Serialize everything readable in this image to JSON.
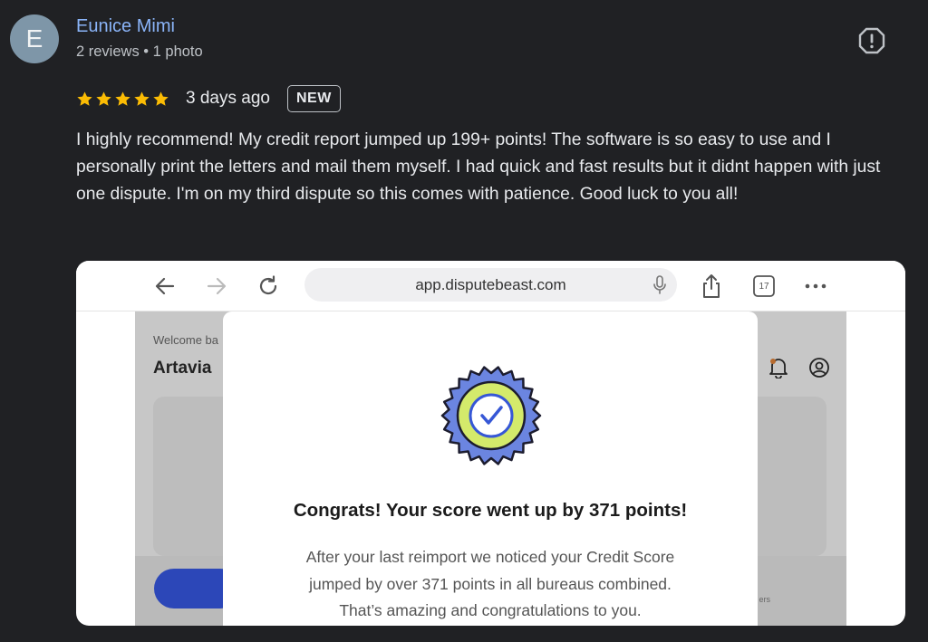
{
  "reviewer": {
    "initial": "E",
    "name": "Eunice Mimi",
    "meta": "2 reviews • 1 photo"
  },
  "review": {
    "stars": 5,
    "star_color": "#fbbc04",
    "date": "3 days ago",
    "badge": "NEW",
    "text": "I highly recommend! My credit report jumped up 199+ points! The software is so easy to use and I personally print the letters and mail them myself. I had quick and fast results but it didnt happen with just one dispute. I'm on my third dispute so this comes with patience. Good luck to you all!"
  },
  "icons": {
    "report": "report-flag-icon"
  },
  "photo": {
    "browser": {
      "url": "app.disputebeast.com",
      "tabs_count": "17"
    },
    "background_page": {
      "welcome": "Welcome ba",
      "name": "Artavia",
      "small_text": "ers"
    },
    "modal": {
      "title": "Congrats! Your score went up by 371 points!",
      "body_line1": "After your last reimport we noticed your Credit Score",
      "body_line2": "jumped by over 371 points in all bureaus combined.",
      "body_line3": "That’s amazing and congratulations to you."
    },
    "colors": {
      "badge_outer": "#6b85e0",
      "badge_inner": "#d4ea6b",
      "check": "#3657d6",
      "primary_button": "#2c47b8"
    }
  }
}
